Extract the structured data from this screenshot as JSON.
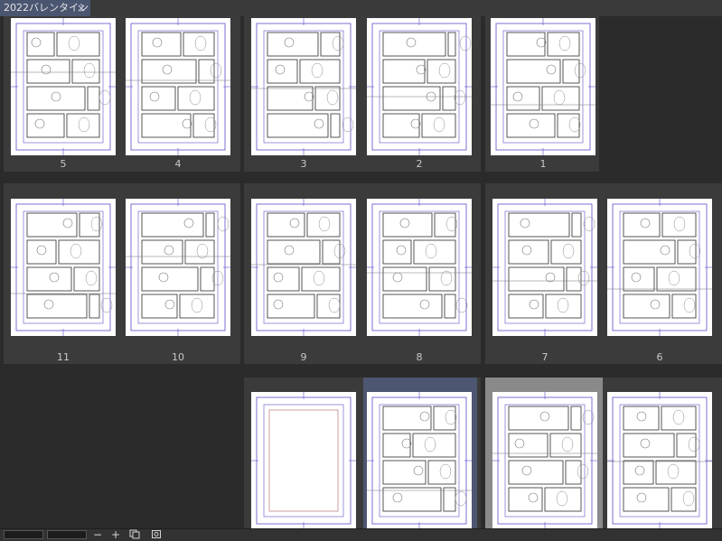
{
  "tab": {
    "title": "2022バレンタイン",
    "close_glyph": "×"
  },
  "pages": {
    "p5": "5",
    "p4": "4",
    "p3": "3",
    "p2": "2",
    "p1": "1",
    "p11": "11",
    "p10": "10",
    "p9": "9",
    "p8": "8",
    "p7": "7",
    "p6": "6"
  },
  "toolbar": {
    "minus": "−",
    "plus": "+",
    "icon_copy": "copy-page-icon",
    "icon_settings": "page-settings-icon"
  },
  "colors": {
    "background": "#2b2b2b",
    "spread": "#3b3b3b",
    "selected_spread": "#4d5670",
    "tab": "#4a5570",
    "guide": "#5a4fc8"
  }
}
